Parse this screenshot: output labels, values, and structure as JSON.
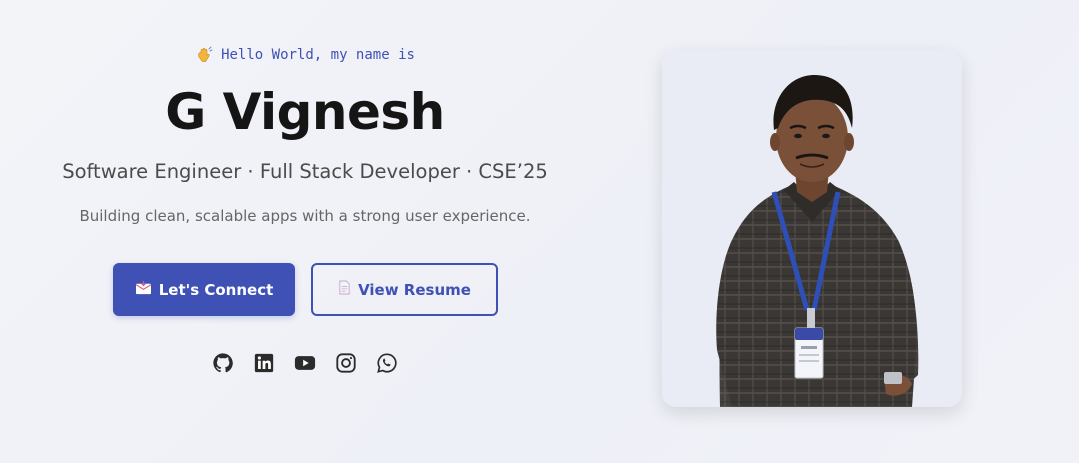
{
  "hero": {
    "greeting": "Hello World, my name is",
    "name": "G Vignesh",
    "subtitle": "Software Engineer · Full Stack Developer · CSE’25",
    "tagline": "Building clean, scalable apps with a strong user experience.",
    "primary_button": {
      "label": "Let's Connect",
      "icon": "envelope-icon"
    },
    "secondary_button": {
      "label": "View Resume",
      "icon": "document-icon"
    },
    "socials": [
      "github-icon",
      "linkedin-icon",
      "youtube-icon",
      "instagram-icon",
      "whatsapp-icon"
    ]
  },
  "colors": {
    "accent": "#3f51b5",
    "heading": "#151515",
    "background": "#f1f2f8"
  }
}
